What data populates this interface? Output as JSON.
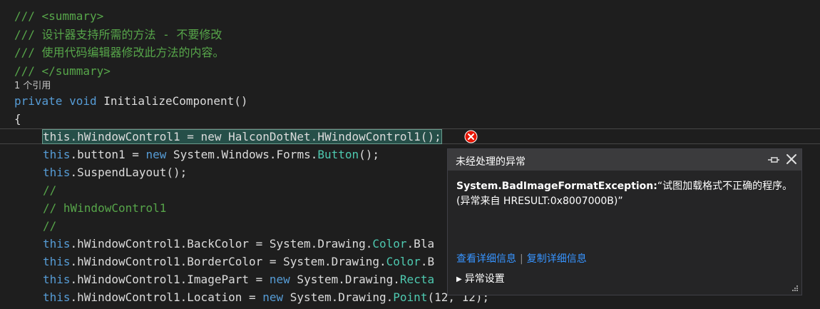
{
  "code": {
    "l1": "/// <summary>",
    "l2": "/// 设计器支持所需的方法 - 不要修改",
    "l3": "/// 使用代码编辑器修改此方法的内容。",
    "l4": "/// </summary>",
    "ref_count": "1 个引用",
    "kw_private": "private",
    "kw_void": "void",
    "method": "InitializeComponent()",
    "brace": "{",
    "current_stmt": "this.hWindowControl1 = new HalconDotNet.HWindowControl1();",
    "kw_this": "this",
    "kw_new": "new",
    "s2_mid": ".button1 = ",
    "s2_ns": "System.Windows.Forms.",
    "s2_type": "Button",
    "s2_end": "();",
    "s3": ".SuspendLayout();",
    "c1": "//",
    "c2": "// hWindowControl1",
    "c3": "//",
    "s7_mid": ".hWindowControl1.BackColor = System.Drawing.",
    "s7_type": "Color",
    "s7_end": ".Bla",
    "s8_mid": ".hWindowControl1.BorderColor = System.Drawing.",
    "s8_type": "Color",
    "s8_end": ".B",
    "s9_mid": ".hWindowControl1.ImagePart = ",
    "s9_ns": " System.Drawing.",
    "s9_type": "Recta",
    "s10_mid": ".hWindowControl1.Location = ",
    "s10_ns": " System.Drawing.",
    "s10_type": "Point",
    "s10_end": "(12, 12);"
  },
  "exception_popup": {
    "title": "未经处理的异常",
    "exception_type": "System.BadImageFormatException:",
    "message": "“试图加载格式不正确的程序。 (异常来自 HRESULT:0x8007000B)”",
    "view_details": "查看详细信息",
    "separator": "|",
    "copy_details": "复制详细信息",
    "settings": "异常设置"
  },
  "icons": {
    "error": "error-circle-icon",
    "pin": "pin-icon",
    "close": "close-icon",
    "expand": "triangle-right-icon",
    "grip": "resize-grip-icon"
  },
  "colors": {
    "background": "#1e1e1e",
    "comment": "#57a64a",
    "keyword": "#569cd6",
    "type": "#4ec9b0",
    "link": "#3794ff",
    "error": "#e51400"
  }
}
